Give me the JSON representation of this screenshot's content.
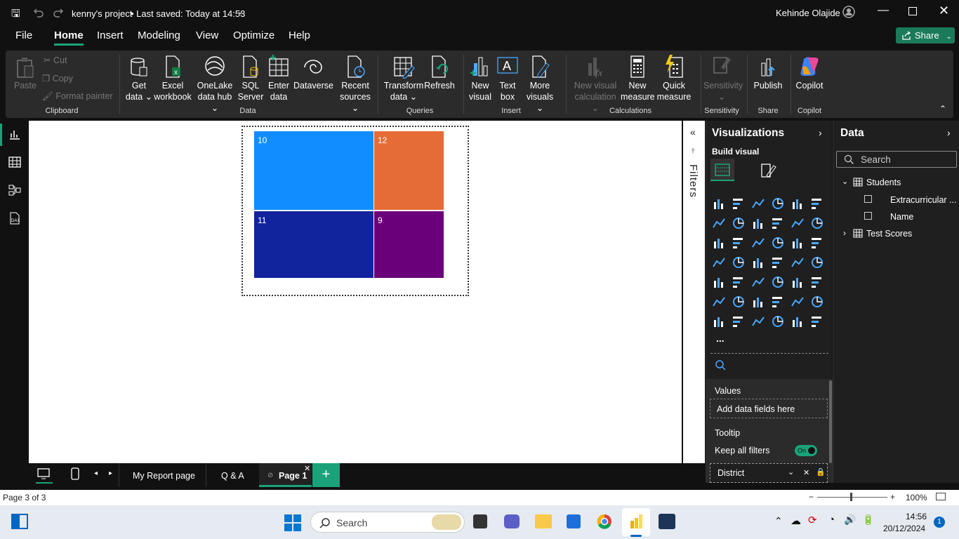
{
  "titlebar": {
    "project": "kenny's project",
    "saved": "• Last saved: Today at 14:53",
    "user": "Kehinde Olajide"
  },
  "menu": {
    "items": [
      "File",
      "Home",
      "Insert",
      "Modeling",
      "View",
      "Optimize",
      "Help"
    ],
    "active": "Home",
    "share": "Share"
  },
  "ribbon": {
    "clipboard": {
      "paste": "Paste",
      "cut": "Cut",
      "copy": "Copy",
      "format_painter": "Format painter",
      "group": "Clipboard"
    },
    "data": {
      "get_data": [
        "Get",
        "data ⌄"
      ],
      "excel": [
        "Excel",
        "workbook"
      ],
      "onelake": [
        "OneLake",
        "data hub ⌄"
      ],
      "sql": [
        "SQL",
        "Server"
      ],
      "enter": [
        "Enter",
        "data"
      ],
      "dataverse": [
        "Dataverse",
        ""
      ],
      "recent": [
        "Recent",
        "sources ⌄"
      ],
      "group": "Data"
    },
    "queries": {
      "transform": [
        "Transform",
        "data ⌄"
      ],
      "refresh": [
        "Refresh",
        ""
      ],
      "group": "Queries"
    },
    "insert": {
      "new_visual": [
        "New",
        "visual"
      ],
      "text_box": [
        "Text",
        "box"
      ],
      "more_visuals": [
        "More",
        "visuals ⌄"
      ],
      "group": "Insert"
    },
    "calculations": {
      "new_visual_calc": [
        "New visual",
        "calculation ⌄"
      ],
      "new_measure": [
        "New",
        "measure"
      ],
      "quick_measure": [
        "Quick",
        "measure"
      ],
      "group": "Calculations"
    },
    "sensitivity": {
      "label": [
        "Sensitivity",
        "⌄"
      ],
      "group": "Sensitivity"
    },
    "share": {
      "publish": "Publish",
      "group": "Share"
    },
    "copilot": {
      "label": "Copilot",
      "group": "Copilot"
    }
  },
  "treemap": {
    "tiles": [
      {
        "label": "10",
        "color": "#118dff"
      },
      {
        "label": "12",
        "color": "#e66c37"
      },
      {
        "label": "11",
        "color": "#12239e"
      },
      {
        "label": "9",
        "color": "#6b007b"
      }
    ]
  },
  "filters": {
    "label": "Filters"
  },
  "visualizations": {
    "title": "Visualizations",
    "build_visual": "Build visual",
    "more": "...",
    "values_label": "Values",
    "values_placeholder": "Add data fields here",
    "tooltip_label": "Tooltip",
    "keep_filters": "Keep all filters",
    "toggle": "On",
    "field": "District"
  },
  "data_pane": {
    "title": "Data",
    "search_placeholder": "Search",
    "tables": [
      {
        "name": "Students",
        "fields": [
          "Extracurricular ...",
          "Name"
        ]
      },
      {
        "name": "Test Scores",
        "fields": []
      }
    ]
  },
  "tabs": {
    "pages": [
      "My Report page",
      "Q & A",
      "Page 1"
    ],
    "active": "Page 1",
    "add": "+"
  },
  "status": {
    "page": "Page 3 of 3",
    "zoom": "100%"
  },
  "taskbar": {
    "search": "Search",
    "time": "14:56",
    "date": "20/12/2024",
    "badge": "1"
  },
  "colors": {
    "accent": "#1aa37a",
    "powerbi_yellow": "#f2c811"
  }
}
